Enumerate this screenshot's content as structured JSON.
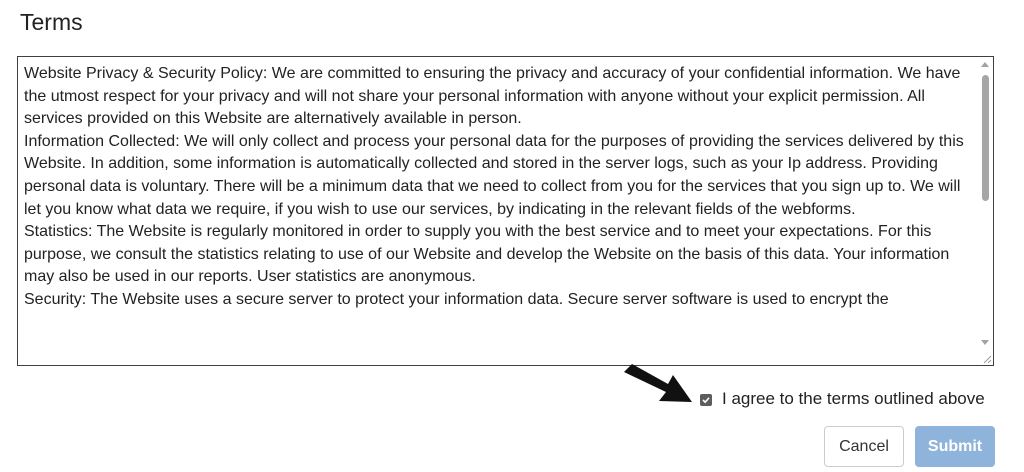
{
  "page": {
    "title": "Terms"
  },
  "terms": {
    "paragraphs": [
      "Website Privacy & Security Policy: We are committed to ensuring the privacy and accuracy of your confidential information. We have the utmost respect for your privacy and will not share your personal information with anyone without your explicit permission. All services provided on this Website are alternatively available in person.",
      "Information Collected: We will only collect and process your personal data for the purposes of providing the services delivered by this Website. In addition, some information is automatically collected and stored in the server logs, such as your Ip address. Providing personal data is voluntary. There will be a minimum data that we need to collect from you for the services that you sign up to. We will let you know what data we require, if you wish to use our services, by indicating in the relevant fields of the webforms.",
      "Statistics: The Website is regularly monitored in order to supply you with the best service and to meet your expectations. For this purpose, we consult the statistics relating to use of our Website and develop the Website on the basis of this data. Your information may also be used in our reports. User statistics are anonymous.",
      "Security: The Website uses a secure server to protect your information data. Secure server software is used to encrypt the"
    ]
  },
  "agree": {
    "checked": true,
    "label": "I agree to the terms outlined above"
  },
  "buttons": {
    "cancel_label": "Cancel",
    "submit_label": "Submit"
  },
  "colors": {
    "submit_bg": "#8fb4dc",
    "checkbox_bg": "#5d5d5d",
    "arrow": "#111111"
  }
}
